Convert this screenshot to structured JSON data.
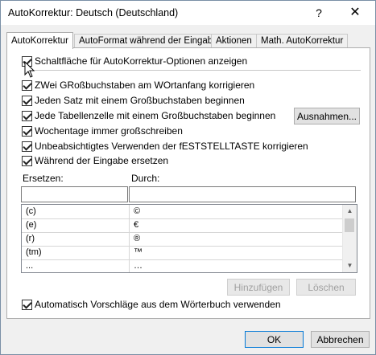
{
  "window": {
    "title": "AutoKorrektur: Deutsch (Deutschland)",
    "help_glyph": "?",
    "close_glyph": "✕"
  },
  "tabs": [
    {
      "label": "AutoKorrektur",
      "active": true
    },
    {
      "label": "AutoFormat während der Eingabe",
      "active": false
    },
    {
      "label": "Aktionen",
      "active": false
    },
    {
      "label": "Math. AutoKorrektur",
      "active": false
    }
  ],
  "options": {
    "show_buttons": {
      "label": "Schaltfläche für AutoKorrektur-Optionen anzeigen",
      "checked": true
    },
    "two_initial_caps": {
      "label": "ZWei GRoßbuchstaben am WOrtanfang korrigieren",
      "checked": true
    },
    "sentence_caps": {
      "label": "Jeden Satz mit einem Großbuchstaben beginnen",
      "checked": true
    },
    "table_cell_caps": {
      "label": "Jede Tabellenzelle mit einem Großbuchstaben beginnen",
      "checked": true
    },
    "weekday_caps": {
      "label": "Wochentage immer großschreiben",
      "checked": true
    },
    "capslock_fix": {
      "label": "Unbeabsichtigtes Verwenden der fESTSTELLTASTE korrigieren",
      "checked": true
    },
    "replace_while_typing": {
      "label": "Während der Eingabe ersetzen",
      "checked": true
    },
    "dictionary_suggestions": {
      "label": "Automatisch Vorschläge aus dem Wörterbuch verwenden",
      "checked": true
    }
  },
  "buttons": {
    "exceptions": "Ausnahmen...",
    "add": "Hinzufügen",
    "delete": "Löschen",
    "ok": "OK",
    "cancel": "Abbrechen"
  },
  "replace": {
    "replace_label": "Ersetzen:",
    "with_label": "Durch:",
    "replace_value": "",
    "with_value": ""
  },
  "entries": [
    {
      "from": "(c)",
      "to": "©"
    },
    {
      "from": "(e)",
      "to": "€"
    },
    {
      "from": "(r)",
      "to": "®"
    },
    {
      "from": "(tm)",
      "to": "™"
    },
    {
      "from": "...",
      "to": "…"
    }
  ]
}
